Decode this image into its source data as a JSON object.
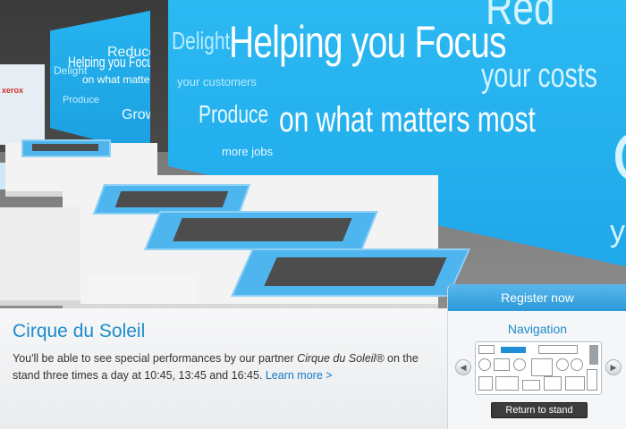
{
  "scene": {
    "banner": {
      "headline_1": "Helping you Focus",
      "headline_2": "on what matters most",
      "word_delight": "Delight",
      "word_delight_sub": "your customers",
      "word_produce": "Produce",
      "word_produce_sub": "more jobs",
      "word_reduce": "Red",
      "word_reduce_sub": "your costs",
      "word_g": "G",
      "word_y": "y"
    },
    "small_banner": {
      "headline_1": "Helping you Focus",
      "headline_2": "on what matters",
      "word_delight": "Delight",
      "word_reduce": "Reduce",
      "word_grow": "Grow",
      "word_produce": "Produce"
    },
    "left_sign_logo": "xerox"
  },
  "caption": {
    "title": "Cirque du Soleil",
    "body_before": "You'll be able to see special performances by our partner ",
    "body_italic": "Cirque du Soleil®",
    "body_after": " on the stand three times a day at 10:45, 13:45 and 16:45. ",
    "learn_more": "Learn more >"
  },
  "panel": {
    "register_label": "Register now",
    "navigation_label": "Navigation",
    "prev_glyph": "◀",
    "next_glyph": "▶",
    "return_label": "Return to stand"
  }
}
